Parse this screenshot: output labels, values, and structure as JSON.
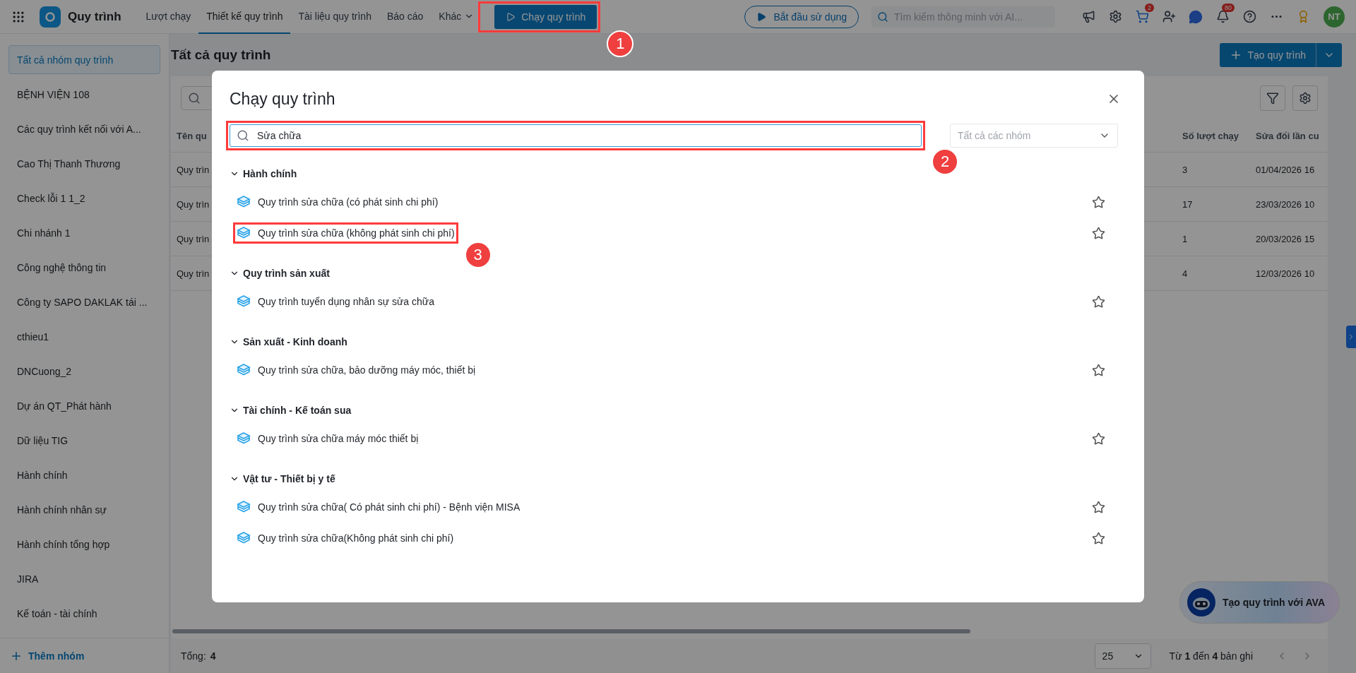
{
  "topbar": {
    "app_name": "Quy trình",
    "nav": [
      {
        "label": "Lượt chạy",
        "selected": false
      },
      {
        "label": "Thiết kế quy trình",
        "selected": true
      },
      {
        "label": "Tài liệu quy trình",
        "selected": false
      },
      {
        "label": "Báo cáo",
        "selected": false
      }
    ],
    "more_label": "Khác",
    "run_button": {
      "label": "Chạy quy trình",
      "annotation": "1"
    },
    "start_button": "Bắt đầu sử dụng",
    "search": {
      "placeholder": "Tìm kiếm thông minh với AI..."
    },
    "cart_badge": "2",
    "bell_badge": "80",
    "avatar": "NT"
  },
  "sidebar": {
    "items": [
      {
        "label": "Tất cả nhóm quy trình",
        "selected": true
      },
      {
        "label": "BỆNH VIỆN 108",
        "selected": false
      },
      {
        "label": "Các quy trình kết nối với A...",
        "selected": false
      },
      {
        "label": "Cao Thị Thanh Thương",
        "selected": false
      },
      {
        "label": "Check lỗi 1 1_2",
        "selected": false
      },
      {
        "label": "Chi nhánh 1",
        "selected": false
      },
      {
        "label": "Công nghệ thông tin",
        "selected": false
      },
      {
        "label": "Công ty SAPO DAKLAK tái ...",
        "selected": false
      },
      {
        "label": "cthieu1",
        "selected": false
      },
      {
        "label": "DNCuong_2",
        "selected": false
      },
      {
        "label": "Dự án QT_Phát hành",
        "selected": false
      },
      {
        "label": "Dữ liệu TIG",
        "selected": false
      },
      {
        "label": "Hành chính",
        "selected": false
      },
      {
        "label": "Hành chính nhân sự",
        "selected": false
      },
      {
        "label": "Hành chính tổng hợp",
        "selected": false
      },
      {
        "label": "JIRA",
        "selected": false
      },
      {
        "label": "Kế toán - tài chính",
        "selected": false
      }
    ],
    "add_label": "Thêm nhóm"
  },
  "main": {
    "title": "Tất cả quy trình",
    "create_button": "Tạo quy trình",
    "table": {
      "columns": [
        "Tên qu",
        "Số lượt chạy",
        "Sửa đổi lần cu"
      ],
      "rows": [
        [
          "Quy trìn",
          "3",
          "01/04/2026 16"
        ],
        [
          "Quy trìn",
          "17",
          "23/03/2026 10"
        ],
        [
          "Quy trìn",
          "1",
          "20/03/2026 15"
        ],
        [
          "Quy trìn",
          "4",
          "12/03/2026 10"
        ]
      ]
    },
    "total_label": "Tổng:",
    "total": "4",
    "page_size": "25",
    "range": "Từ **1** đến **4** bản ghi"
  },
  "ava_button": "Tạo quy trình với AVA",
  "modal": {
    "title": "Chạy quy trình",
    "search": {
      "value": "Sửa chữa",
      "annotation": "2"
    },
    "group_select": {
      "placeholder": "Tất cả các nhóm"
    },
    "groups": [
      {
        "name": "Hành chính",
        "expanded": true,
        "items": [
          {
            "label": "Quy trình sửa chữa (có phát sinh chi phí)",
            "starred": false
          },
          {
            "label": "Quy trình sửa chữa (không phát sinh chi phí)",
            "starred": false,
            "annotation": "3"
          }
        ]
      },
      {
        "name": "Quy trình sản xuất",
        "expanded": true,
        "items": [
          {
            "label": "Quy trình tuyển dụng nhân sự sửa chữa",
            "starred": false
          }
        ]
      },
      {
        "name": "Sản xuất - Kinh doanh",
        "expanded": true,
        "items": [
          {
            "label": "Quy trình sửa chữa, bảo dưỡng máy móc, thiết bị",
            "starred": false
          }
        ]
      },
      {
        "name": "Tài chính - Kế toán sua",
        "expanded": true,
        "items": [
          {
            "label": "Quy trình sửa chữa máy móc thiết bị",
            "starred": false
          }
        ]
      },
      {
        "name": "Vật tư - Thiết bị y tế",
        "expanded": true,
        "items": [
          {
            "label": "Quy trình sửa chữa( Có phát sinh chi phí) - Bệnh viện MISA",
            "starred": false
          },
          {
            "label": "Quy trình sửa chữa(Không phát sinh chi phí)",
            "starred": false
          }
        ]
      }
    ]
  }
}
